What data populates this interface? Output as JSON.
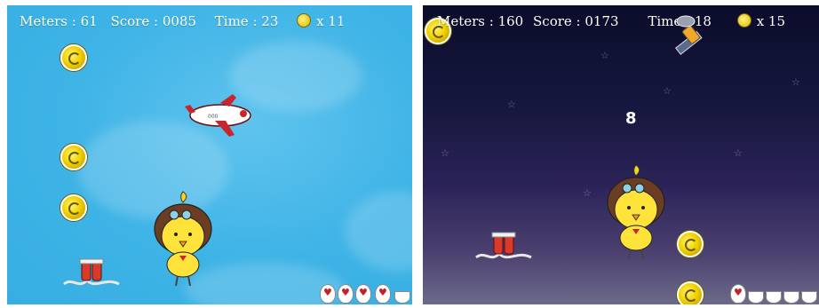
{
  "left_panel": {
    "hud": {
      "meters": "Meters : 61",
      "score": "Score : 0085",
      "time": "Time : 23",
      "coins": "x 11"
    }
  },
  "right_panel": {
    "hud": {
      "meters": "Meters : 160",
      "score": "Score : 0173",
      "time": "Time : 18",
      "coins": "x 15"
    },
    "countdown": "8"
  },
  "colors": {
    "sky": "#3db3e6",
    "night": "#17183f",
    "coin": "#f2d200",
    "heart": "#c81e2a"
  },
  "icons": [
    "coin-icon",
    "airplane-icon",
    "chick-pilot-icon",
    "jetpack-icon",
    "satellite-icon",
    "heart-egg-icon"
  ]
}
